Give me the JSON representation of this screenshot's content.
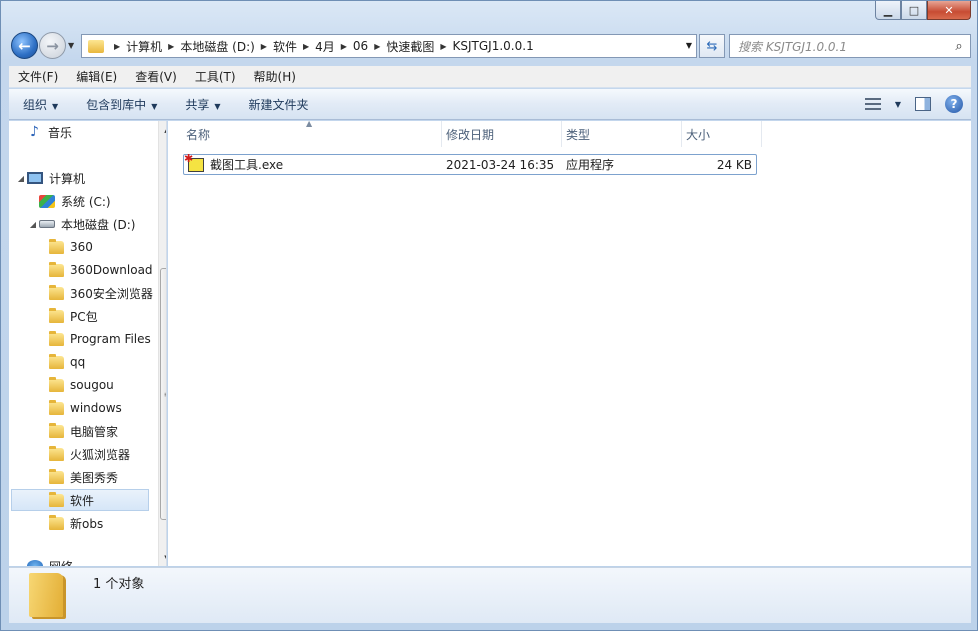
{
  "window": {
    "minimize": "▁",
    "maximize": "□",
    "close": "✕"
  },
  "address": {
    "crumbs": [
      "计算机",
      "本地磁盘 (D:)",
      "软件",
      "4月",
      "06",
      "快速截图",
      "KSJTGJ1.0.0.1"
    ]
  },
  "search": {
    "placeholder": "搜索 KSJTGJ1.0.0.1"
  },
  "menu": [
    "文件(F)",
    "编辑(E)",
    "查看(V)",
    "工具(T)",
    "帮助(H)"
  ],
  "commands": {
    "organize": "组织",
    "include_in_library": "包含到库中",
    "share": "共享",
    "new_folder": "新建文件夹"
  },
  "nav": {
    "music": "音乐",
    "computer": "计算机",
    "system_drive": "系统 (C:)",
    "local_drive": "本地磁盘 (D:)",
    "folders": [
      "360",
      "360Download",
      "360安全浏览器",
      "PC包",
      "Program Files",
      "qq",
      "sougou",
      "windows",
      "电脑管家",
      "火狐浏览器",
      "美图秀秀",
      "软件",
      "新obs"
    ],
    "selected_folder": "软件",
    "network": "网络"
  },
  "columns": {
    "name": "名称",
    "modified": "修改日期",
    "type": "类型",
    "size": "大小"
  },
  "files": [
    {
      "name": "截图工具.exe",
      "modified": "2021-03-24 16:35",
      "type": "应用程序",
      "size": "24 KB"
    }
  ],
  "details": {
    "count": "1 个对象"
  },
  "colors": {
    "accent": "#2d6fc4",
    "selection_border": "#7da2ce"
  }
}
